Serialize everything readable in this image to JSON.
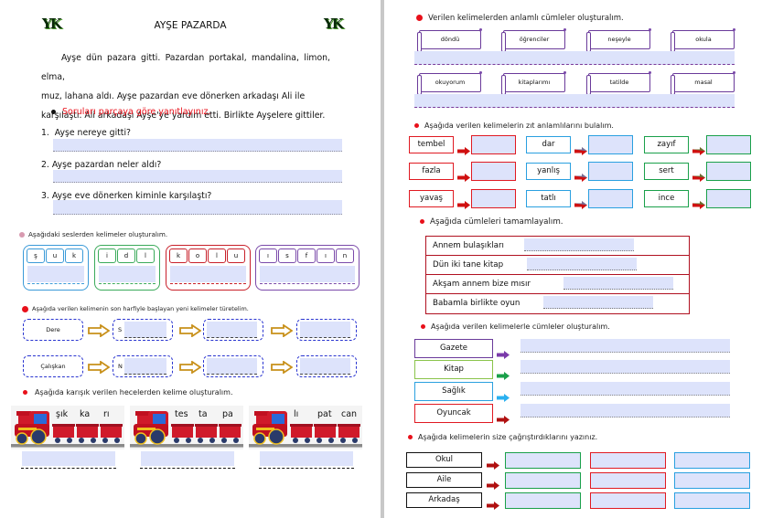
{
  "left_page": {
    "logo_text": "YK",
    "title": "AYŞE PAZARDA",
    "story_lines": [
      "Ayşe dün pazara gitti. Pazardan portakal, mandalina, limon, elma,",
      "muz, lahana aldı. Ayşe pazardan eve dönerken arkadaşı Ali ile",
      "karşılaştı. Ali arkadaşı Ayşe'ye yardım etti. Birlikte Ayşelere gittiler."
    ],
    "questions_instruction": "Soruları parçaya göre yanıtlayınız.",
    "questions": [
      {
        "num": "1.",
        "text": "Ayşe nereye gitti?"
      },
      {
        "num": "2.",
        "text": "Ayşe pazardan neler aldı?"
      },
      {
        "num": "3.",
        "text": "Ayşe eve dönerken kiminle karşılaştı?"
      }
    ],
    "letters_instruction": "Aşağıdaki seslerden kelimeler oluşturalım.",
    "letter_groups": [
      {
        "letters": [
          "ş",
          "u",
          "k"
        ],
        "color": "#3a9ad8"
      },
      {
        "letters": [
          "i",
          "d",
          "l"
        ],
        "color": "#3aaa5a"
      },
      {
        "letters": [
          "k",
          "o",
          "l",
          "u"
        ],
        "color": "#c8202a"
      },
      {
        "letters": [
          "ı",
          "s",
          "f",
          "ı",
          "n"
        ],
        "color": "#7a4aaa"
      }
    ],
    "chain_instruction": "Aşağıda verilen kelimenin son harfiyle başlayan yeni kelimeler türetelim.",
    "chain_rows": [
      {
        "word": "Dere",
        "prefix": "S"
      },
      {
        "word": "Çalışkan",
        "prefix": "N"
      }
    ],
    "syllables_instruction": "Aşağıda karışık verilen hecelerden kelime oluşturalım.",
    "trains": [
      {
        "syllables": [
          "şık",
          "ka",
          "rı"
        ]
      },
      {
        "syllables": [
          "tes",
          "ta",
          "pa"
        ]
      },
      {
        "syllables": [
          "lı",
          "pat",
          "can"
        ]
      }
    ]
  },
  "right_page": {
    "sentences_instruction": "Verilen kelimelerden anlamlı cümleler oluşturalım.",
    "sentence_rows": [
      [
        "döndü",
        "öğrenciler",
        "neşeyle",
        "okula"
      ],
      [
        "okuyorum",
        "kitaplarımı",
        "tatilde",
        "masal"
      ]
    ],
    "opposites_instruction": "Aşağıda verilen kelimelerin zıt anlamlılarını bulalım.",
    "opposites_columns": [
      {
        "color": "#e01a22",
        "words": [
          "tembel",
          "fazla",
          "yavaş"
        ]
      },
      {
        "color": "#2aa0e0",
        "words": [
          "dar",
          "yanlış",
          "tatlı"
        ]
      },
      {
        "color": "#1aa04a",
        "words": [
          "zayıf",
          "sert",
          "ince"
        ]
      }
    ],
    "complete_instruction": "Aşağıda cümleleri tamamlayalım.",
    "complete_rows": [
      "Annem bulaşıkları",
      "Dün iki tane kitap",
      "Akşam annem bize mısır",
      "Babamla birlikte oyun"
    ],
    "make_sentences_instruction": "Aşağıda verilen kelimelerle cümleler oluşturalım.",
    "make_sentences_words": [
      {
        "word": "Gazete",
        "color": "#6a3a9a",
        "arrow_color": "#7a3aaa"
      },
      {
        "word": "Kitap",
        "color": "#8ac44a",
        "arrow_color": "#1aa04a"
      },
      {
        "word": "Sağlık",
        "color": "#2aa0e0",
        "arrow_color": "#2ab0f0"
      },
      {
        "word": "Oyuncak",
        "color": "#e01a22",
        "arrow_color": "#b01010"
      }
    ],
    "associations_instruction": "Aşağıda kelimelerin size çağrıştırdıklarını yazınız.",
    "associations_words": [
      "Okul",
      "Aile",
      "Arkadaş"
    ],
    "associations_column_colors": [
      "#1aa04a",
      "#e01a22",
      "#2aa0e0"
    ]
  }
}
